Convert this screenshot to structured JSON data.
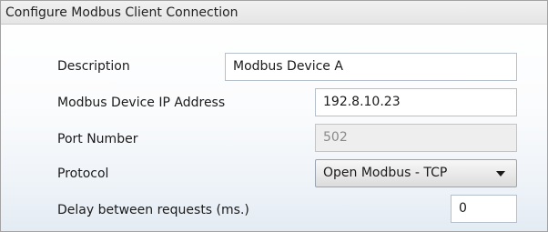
{
  "dialog": {
    "title": "Configure Modbus Client Connection"
  },
  "form": {
    "description": {
      "label": "Description",
      "value": "Modbus Device A"
    },
    "ip_address": {
      "label": "Modbus Device IP Address",
      "value": "192.8.10.23"
    },
    "port": {
      "label": "Port Number",
      "value": "502",
      "disabled": true
    },
    "protocol": {
      "label": "Protocol",
      "selected": "Open Modbus - TCP",
      "icon": "chevron-down-icon"
    },
    "delay": {
      "label": "Delay between requests (ms.)",
      "value": "0"
    }
  }
}
